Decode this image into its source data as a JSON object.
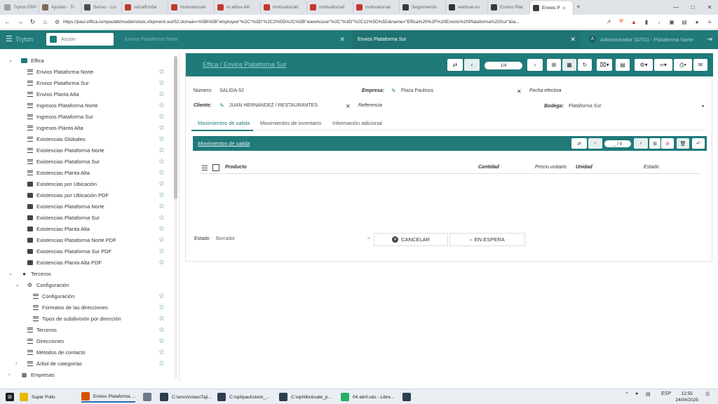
{
  "browser": {
    "tabs": [
      {
        "label": "Tryton ERP",
        "color": "#9aa0a6",
        "w": 54
      },
      {
        "label": "Ajustes - Tr",
        "color": "#7a6a5a",
        "w": 60
      },
      {
        "label": "Senso - Lin",
        "color": "#4a4a4a",
        "w": 58
      },
      {
        "label": "nimalEmfat",
        "color": "#c0392b",
        "w": 66
      },
      {
        "label": "motivationali",
        "color": "#c0392b",
        "w": 66
      },
      {
        "label": "m.alhuv.Alil",
        "color": "#c0392b",
        "w": 66
      },
      {
        "label": "motivationali",
        "color": "#c0392b",
        "w": 66
      },
      {
        "label": "motivationali",
        "color": "#c0392b",
        "w": 66
      },
      {
        "label": "motivationali",
        "color": "#c0392b",
        "w": 66
      },
      {
        "label": "Seguimiento",
        "color": "#3a3a3a",
        "w": 66
      },
      {
        "label": "webinar.es",
        "color": "#333333",
        "w": 60
      },
      {
        "label": "Envios Plat",
        "color": "#3a3a3a",
        "w": 60
      },
      {
        "label": "Envios P",
        "color": "#3a3a3a",
        "w": 62,
        "active": true
      }
    ],
    "url": "https://paul.effica.io/#pauldb/model/stock.shipment.out/52;domain=%5B%5B\"employee\"%2C\"%3D\"%2C2%5D%2C%5B\"warehouse\"%2C\"%3D\"%2C12%5D%5D&name=\"Effica%20%2F%20Envios%20Plataforma%20Sur\"&ta..."
  },
  "app": {
    "brand": "Tryton",
    "search_placeholder": "Acción",
    "tab1_label": "Envios Plataforma Norte",
    "tab2_label": "Envios Plataforma Sur",
    "user": "Administrador (GTG) - Plataforma Norte",
    "user_initial": "A"
  },
  "sidebar": [
    {
      "label": "Effica",
      "level": 0,
      "icon": "folder",
      "chev": "down",
      "star": false
    },
    {
      "label": "Envios Plataforma Norte",
      "level": 1,
      "icon": "list",
      "star": true
    },
    {
      "label": "Envios Plataforma Sur",
      "level": 1,
      "icon": "list",
      "star": true
    },
    {
      "label": "Envios Planta Alta",
      "level": 1,
      "icon": "list",
      "star": true
    },
    {
      "label": "Ingresos Plataforma Norte",
      "level": 1,
      "icon": "list",
      "star": true
    },
    {
      "label": "Ingresos Plataforma Sur",
      "level": 1,
      "icon": "list",
      "star": true
    },
    {
      "label": "Ingresos Planta Alta",
      "level": 1,
      "icon": "list",
      "star": true
    },
    {
      "label": "Existencias Globales",
      "level": 1,
      "icon": "list",
      "star": true
    },
    {
      "label": "Existencias Plataforma Norte",
      "level": 1,
      "icon": "list",
      "star": true
    },
    {
      "label": "Existencias Plataforma Sur",
      "level": 1,
      "icon": "list",
      "star": true
    },
    {
      "label": "Existencias Planta Alta",
      "level": 1,
      "icon": "list",
      "star": true
    },
    {
      "label": "Existencias por Ubicación",
      "level": 1,
      "icon": "print",
      "star": true
    },
    {
      "label": "Existencias por Ubicación PDF",
      "level": 1,
      "icon": "print",
      "star": true
    },
    {
      "label": "Existencias Plataforma Norte",
      "level": 1,
      "icon": "print",
      "star": true
    },
    {
      "label": "Existencias Plataforma Sur",
      "level": 1,
      "icon": "print",
      "star": true
    },
    {
      "label": "Existencias Planta Alta",
      "level": 1,
      "icon": "print",
      "star": true
    },
    {
      "label": "Existencias Plataforma Norte PDF",
      "level": 1,
      "icon": "print",
      "star": true
    },
    {
      "label": "Existencias Plataforma Sur PDF",
      "level": 1,
      "icon": "print",
      "star": true
    },
    {
      "label": "Existencias Planta Alta PDF",
      "level": 1,
      "icon": "print",
      "star": true
    },
    {
      "label": "Terceros",
      "level": 0,
      "icon": "person",
      "chev": "down",
      "star": false
    },
    {
      "label": "Configuración",
      "level": 1,
      "icon": "gear",
      "chev": "down",
      "star": false
    },
    {
      "label": "Configuración",
      "level": 2,
      "icon": "list",
      "star": true
    },
    {
      "label": "Formatos de las direcciones",
      "level": 2,
      "icon": "list",
      "star": true
    },
    {
      "label": "Tipos de subdivisión por dirección",
      "level": 2,
      "icon": "list",
      "star": true
    },
    {
      "label": "Terceros",
      "level": 1,
      "icon": "list",
      "star": true
    },
    {
      "label": "Direcciones",
      "level": 1,
      "icon": "list",
      "star": true
    },
    {
      "label": "Métodos de contacto",
      "level": 1,
      "icon": "list",
      "star": true
    },
    {
      "label": "Árbol de categorías",
      "level": 1,
      "icon": "list",
      "chev": "right",
      "star": true
    },
    {
      "label": "Empresas",
      "level": 0,
      "icon": "building",
      "chev": "right",
      "star": false
    }
  ],
  "form": {
    "title": "Effica / Envios Plataforma Sur",
    "pager": "1/4",
    "numero_label": "Número:",
    "numero_value": "SALIDA-52",
    "empresa_label": "Empresa:",
    "empresa_value": "Plaza Paulinos",
    "fecha_label": "Fecha efectiva",
    "cliente_label": "Cliente:",
    "cliente_value": "JUAN HERNANDEZ / RESTAURANTES",
    "referencia_label": "Referencia",
    "bodega_label": "Bodega:",
    "bodega_value": "Plataforma Sur",
    "tabs": [
      "Movimientos de salida",
      "Movimientos de inventario",
      "Información adicional"
    ],
    "moves_title": "Movimientos de salida",
    "moves_pager": "_ / 0",
    "columns": [
      "Producto",
      "Cantidad",
      "Precio unitario",
      "Unidad",
      "Estado"
    ],
    "estado_label": "Estado",
    "estado_value": "Borrador",
    "cancel_label": "CANCELAR",
    "wait_label": "EN ESPERA"
  },
  "taskbar": {
    "items": [
      {
        "label": "Super Pollo",
        "color": "#e6b800"
      },
      {
        "label": "Envios Plataforma ...",
        "color": "#d35400"
      },
      {
        "label": "",
        "color": "#6c7a89"
      },
      {
        "label": "C:\\envs\\notas\\Taji...",
        "color": "#2c3e50"
      },
      {
        "label": "C:\\opt\\paul\\stock_...",
        "color": "#2c3e50"
      },
      {
        "label": "C:\\opt\\libra\\sale_p...",
        "color": "#2c3e50"
      },
      {
        "label": "04 abril.ods - Libre...",
        "color": "#27ae60"
      },
      {
        "label": "",
        "color": "#2c3e50"
      }
    ],
    "lang": "ESP",
    "time": "12:55",
    "date": "24/04/2025"
  }
}
